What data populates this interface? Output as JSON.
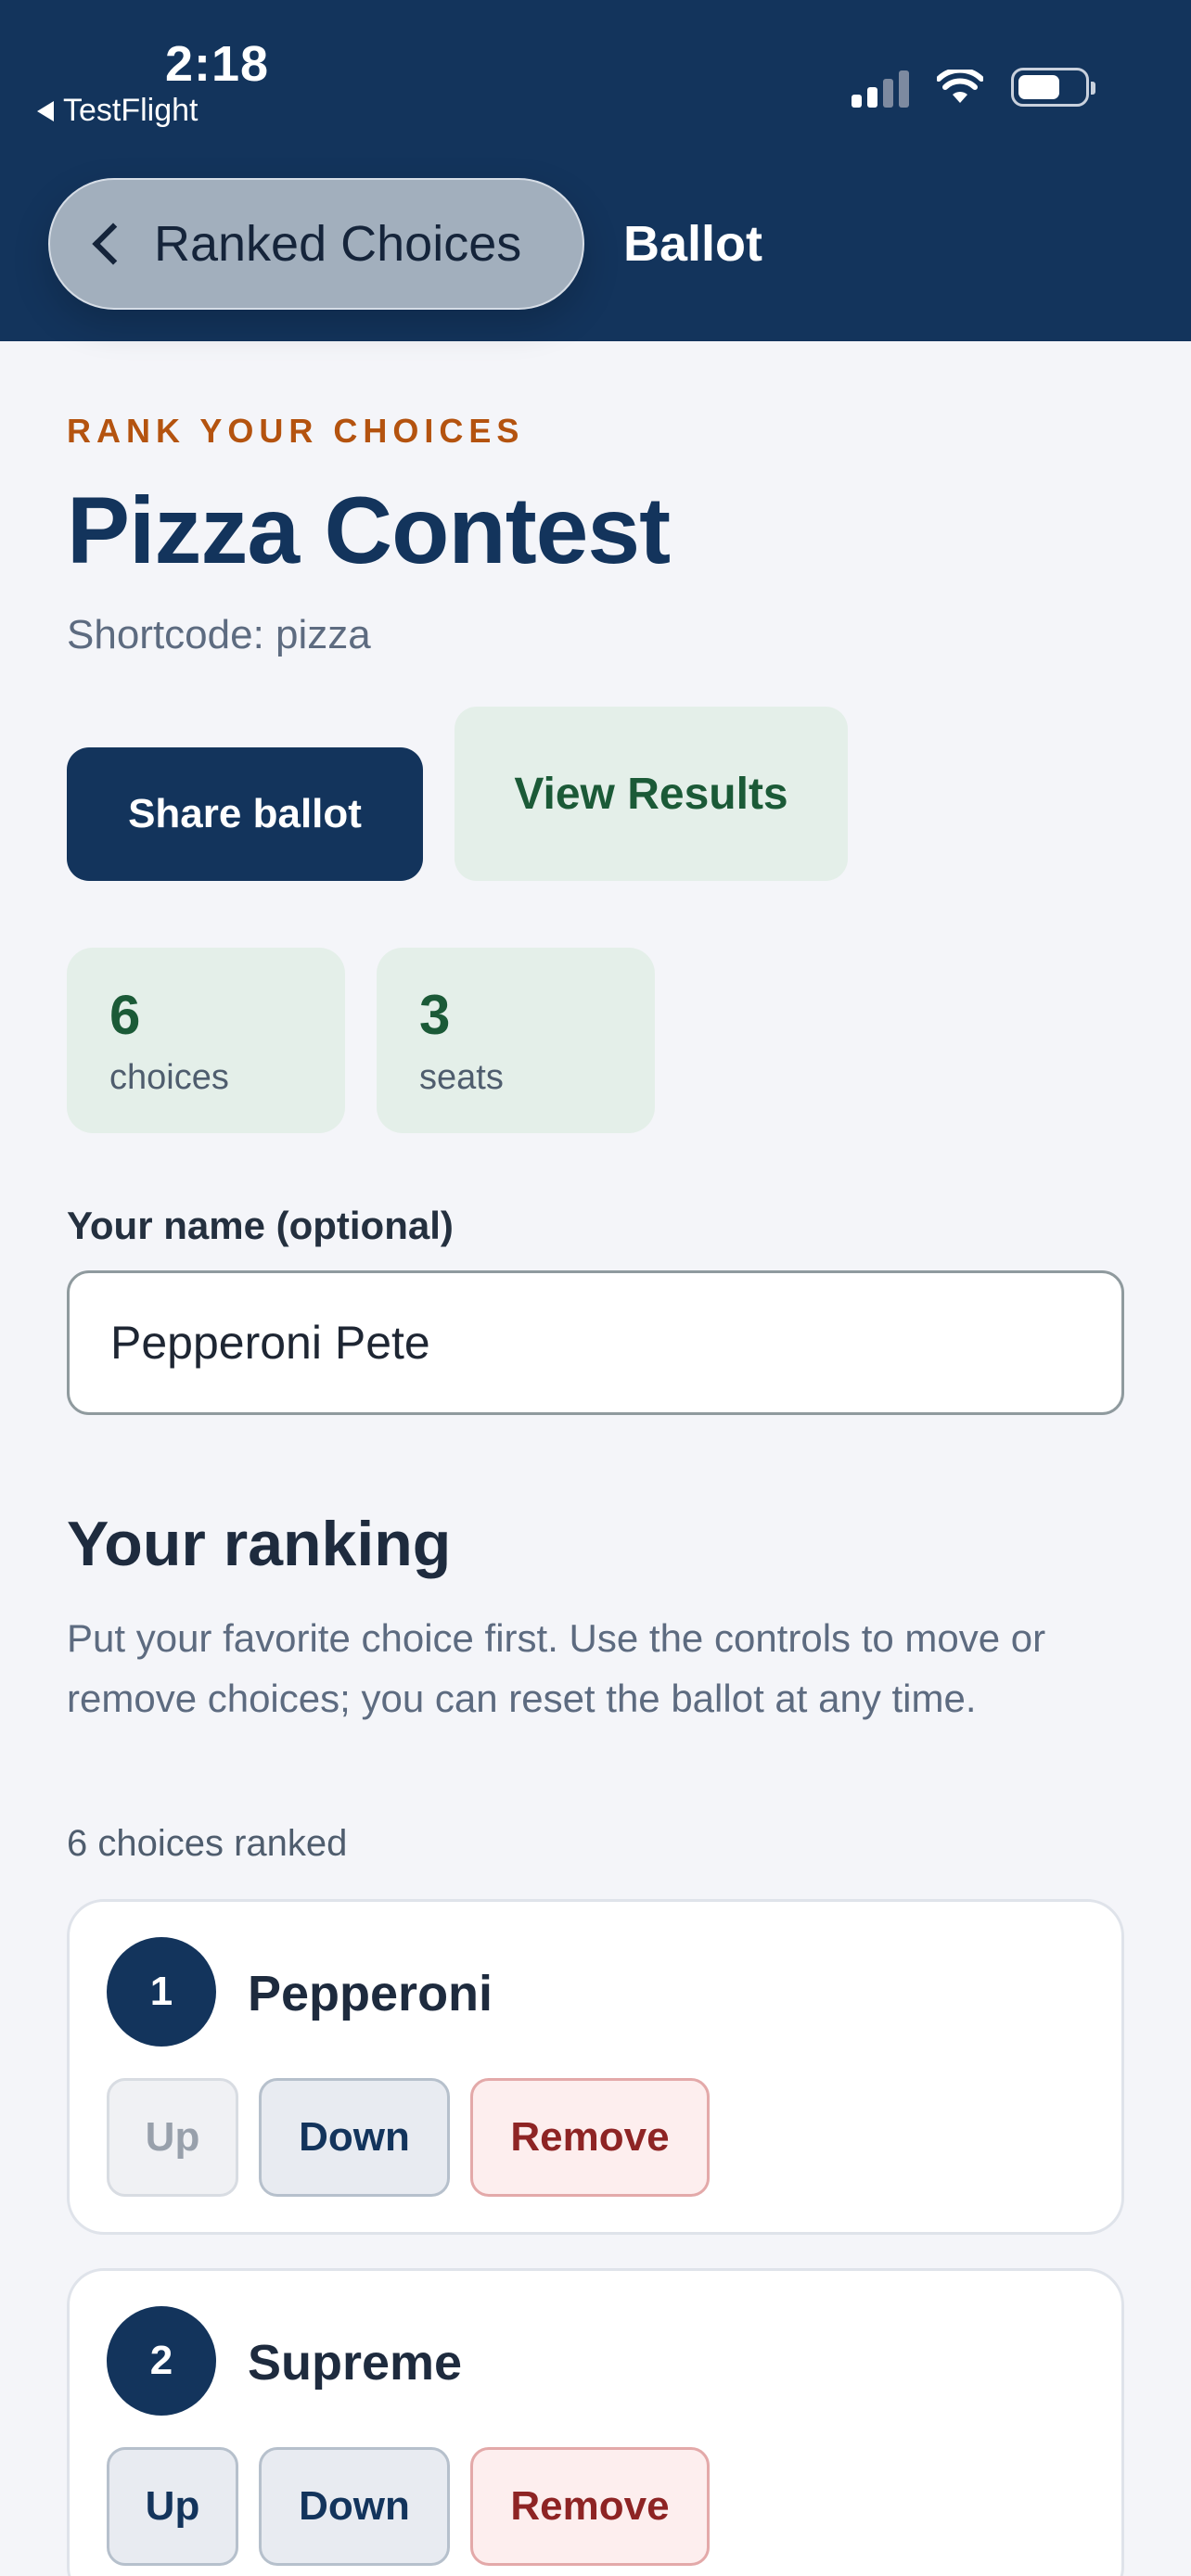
{
  "status_bar": {
    "time": "2:18",
    "back_app": "TestFlight"
  },
  "nav": {
    "back_label": "Ranked Choices",
    "title": "Ballot"
  },
  "page": {
    "eyebrow": "RANK YOUR CHOICES",
    "title": "Pizza Contest",
    "shortcode": "Shortcode: pizza"
  },
  "actions": {
    "share_label": "Share ballot",
    "results_label": "View Results"
  },
  "stats": [
    {
      "value": "6",
      "label": "choices"
    },
    {
      "value": "3",
      "label": "seats"
    }
  ],
  "name_field": {
    "label": "Your name (optional)",
    "value": "Pepperoni Pete"
  },
  "ranking": {
    "title": "Your ranking",
    "description": "Put your favorite choice first. Use the controls to move or remove choices; you can reset the ballot at any time.",
    "count_text": "6 choices ranked",
    "items": [
      {
        "rank": "1",
        "name": "Pepperoni",
        "up": "Up",
        "down": "Down",
        "remove": "Remove"
      },
      {
        "rank": "2",
        "name": "Supreme",
        "up": "Up",
        "down": "Down",
        "remove": "Remove"
      }
    ]
  },
  "icons": {
    "status": [
      "back-triangle-icon",
      "cellular-signal-icon",
      "wifi-icon",
      "battery-icon"
    ],
    "nav": "chevron-left-icon"
  },
  "colors": {
    "header": "#13345c",
    "accent_orange": "#b4530f",
    "success_green": "#1b5a37",
    "danger_red": "#8e2424"
  }
}
